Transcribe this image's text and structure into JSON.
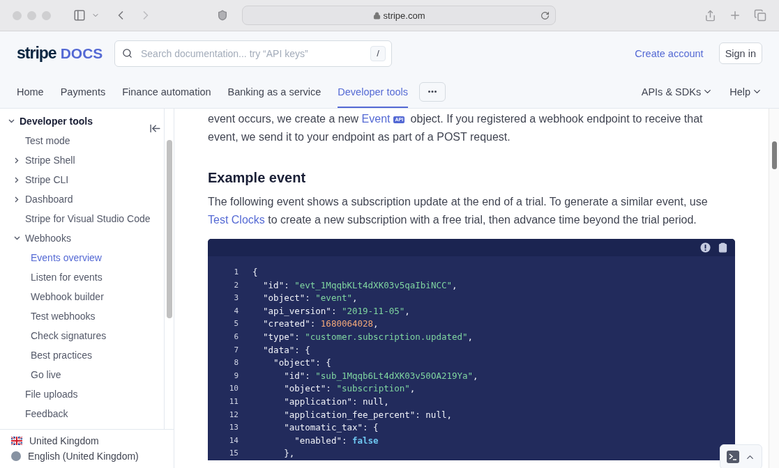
{
  "browser": {
    "url": "stripe.com"
  },
  "header": {
    "logo": {
      "brand": "stripe",
      "product": "DOCS"
    },
    "search": {
      "placeholder": "Search documentation... try “API keys”",
      "shortcut": "/"
    },
    "create_account": "Create account",
    "sign_in": "Sign in"
  },
  "nav": {
    "tabs": [
      {
        "label": "Home",
        "selected": false
      },
      {
        "label": "Payments",
        "selected": false
      },
      {
        "label": "Finance automation",
        "selected": false
      },
      {
        "label": "Banking as a service",
        "selected": false
      },
      {
        "label": "Developer tools",
        "selected": true
      }
    ],
    "menus": [
      {
        "label": "APIs & SDKs"
      },
      {
        "label": "Help"
      }
    ]
  },
  "sidebar": {
    "items": [
      {
        "label": "Developer tools",
        "expanded": true,
        "selected": false,
        "children": [
          {
            "label": "Test mode",
            "selected": false
          },
          {
            "label": "Stripe Shell",
            "expanded": false,
            "selected": false
          },
          {
            "label": "Stripe CLI",
            "expanded": false,
            "selected": false
          },
          {
            "label": "Dashboard",
            "expanded": false,
            "selected": false
          },
          {
            "label": "Stripe for Visual Studio Code",
            "selected": false
          },
          {
            "label": "Webhooks",
            "expanded": true,
            "selected": false,
            "children": [
              {
                "label": "Events overview",
                "selected": true
              },
              {
                "label": "Listen for events",
                "selected": false
              },
              {
                "label": "Webhook builder",
                "selected": false
              },
              {
                "label": "Test webhooks",
                "selected": false
              },
              {
                "label": "Check signatures",
                "selected": false
              },
              {
                "label": "Best practices",
                "selected": false
              },
              {
                "label": "Go live",
                "selected": false
              }
            ]
          },
          {
            "label": "File uploads",
            "selected": false
          },
          {
            "label": "Feedback",
            "selected": false
          }
        ]
      }
    ],
    "footer": [
      {
        "kind": "flag",
        "label": "United Kingdom"
      },
      {
        "kind": "language",
        "label": "English (United Kingdom)"
      }
    ]
  },
  "content": {
    "intro": [
      {
        "kind": "text",
        "text": "event occurs, we create a new "
      },
      {
        "kind": "link",
        "text": "Event"
      },
      {
        "kind": "badge",
        "text": "API"
      },
      {
        "kind": "text",
        "text": " object. If you registered a webhook endpoint to receive that event, we send it to your endpoint as part of a POST request."
      }
    ],
    "heading": "Example event",
    "paragraph": [
      {
        "kind": "text",
        "text": "The following event shows a subscription update at the end of a trial. To generate a similar event, use "
      },
      {
        "kind": "link",
        "text": "Test Clocks"
      },
      {
        "kind": "text",
        "text": " to create a new subscription with a free trial, then advance time beyond the trial period."
      }
    ],
    "code": {
      "lines": [
        {
          "number": "1",
          "tokens": [
            {
              "kind": "plain",
              "text": "{"
            }
          ]
        },
        {
          "number": "2",
          "tokens": [
            {
              "kind": "plain",
              "text": "  \"id\": "
            },
            {
              "kind": "string",
              "text": "\"evt_1MqqbKLt4dXK03v5qaIbiNCC\""
            },
            {
              "kind": "plain",
              "text": ","
            }
          ]
        },
        {
          "number": "3",
          "tokens": [
            {
              "kind": "plain",
              "text": "  \"object\": "
            },
            {
              "kind": "string",
              "text": "\"event\""
            },
            {
              "kind": "plain",
              "text": ","
            }
          ]
        },
        {
          "number": "4",
          "tokens": [
            {
              "kind": "plain",
              "text": "  \"api_version\": "
            },
            {
              "kind": "string",
              "text": "\"2019-11-05\""
            },
            {
              "kind": "plain",
              "text": ","
            }
          ]
        },
        {
          "number": "5",
          "tokens": [
            {
              "kind": "plain",
              "text": "  \"created\": "
            },
            {
              "kind": "number",
              "text": "1680064028"
            },
            {
              "kind": "plain",
              "text": ","
            }
          ]
        },
        {
          "number": "6",
          "tokens": [
            {
              "kind": "plain",
              "text": "  \"type\": "
            },
            {
              "kind": "string",
              "text": "\"customer.subscription.updated\""
            },
            {
              "kind": "plain",
              "text": ","
            }
          ]
        },
        {
          "number": "7",
          "tokens": [
            {
              "kind": "plain",
              "text": "  \"data\": {"
            }
          ]
        },
        {
          "number": "8",
          "tokens": [
            {
              "kind": "plain",
              "text": "    \"object\": {"
            }
          ]
        },
        {
          "number": "9",
          "tokens": [
            {
              "kind": "plain",
              "text": "      \"id\": "
            },
            {
              "kind": "string",
              "text": "\"sub_1Mqqb6Lt4dXK03v50OA219Ya\""
            },
            {
              "kind": "plain",
              "text": ","
            }
          ]
        },
        {
          "number": "10",
          "tokens": [
            {
              "kind": "plain",
              "text": "      \"object\": "
            },
            {
              "kind": "string",
              "text": "\"subscription\""
            },
            {
              "kind": "plain",
              "text": ","
            }
          ]
        },
        {
          "number": "11",
          "tokens": [
            {
              "kind": "plain",
              "text": "      \"application\": null,"
            }
          ]
        },
        {
          "number": "12",
          "tokens": [
            {
              "kind": "plain",
              "text": "      \"application_fee_percent\": null,"
            }
          ]
        },
        {
          "number": "13",
          "tokens": [
            {
              "kind": "plain",
              "text": "      \"automatic_tax\": {"
            }
          ]
        },
        {
          "number": "14",
          "tokens": [
            {
              "kind": "plain",
              "text": "        \"enabled\": "
            },
            {
              "kind": "keyword",
              "text": "false"
            }
          ]
        },
        {
          "number": "15",
          "tokens": [
            {
              "kind": "plain",
              "text": "      },"
            }
          ]
        }
      ]
    }
  }
}
